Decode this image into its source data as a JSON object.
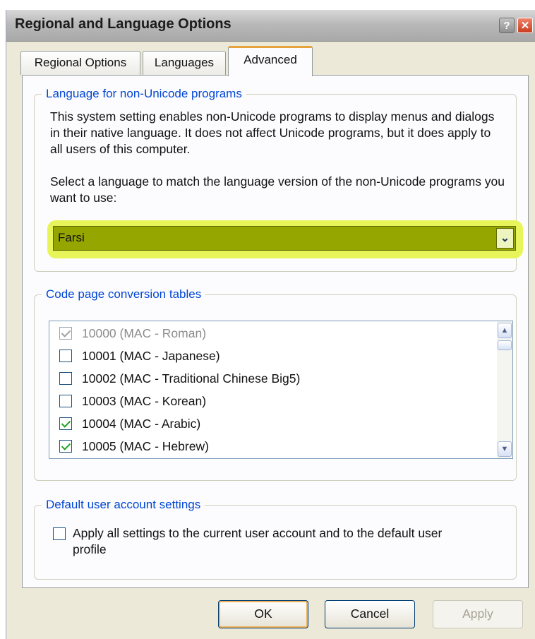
{
  "window": {
    "title": "Regional and Language Options",
    "help_label": "?",
    "close_label": "✕"
  },
  "tabs": [
    {
      "label": "Regional Options"
    },
    {
      "label": "Languages"
    },
    {
      "label": "Advanced"
    }
  ],
  "nonunicode": {
    "legend": "Language for non-Unicode programs",
    "description": "This system setting enables non-Unicode programs to display menus and dialogs in their native language. It does not affect Unicode programs, but it does apply to all users of this computer.",
    "select_prompt": "Select a language to match the language version of the non-Unicode programs you want to use:",
    "selected_language": "Farsi",
    "dropdown_icon": "chevron-down-icon"
  },
  "codepages": {
    "legend": "Code page conversion tables",
    "items": [
      {
        "label": "10000 (MAC - Roman)",
        "checked": true,
        "disabled": true
      },
      {
        "label": "10001 (MAC - Japanese)",
        "checked": false,
        "disabled": false
      },
      {
        "label": "10002 (MAC - Traditional Chinese Big5)",
        "checked": false,
        "disabled": false
      },
      {
        "label": "10003 (MAC - Korean)",
        "checked": false,
        "disabled": false
      },
      {
        "label": "10004 (MAC - Arabic)",
        "checked": true,
        "disabled": false
      },
      {
        "label": "10005 (MAC - Hebrew)",
        "checked": true,
        "disabled": false
      }
    ]
  },
  "defaults": {
    "legend": "Default user account settings",
    "apply_all_label": "Apply all settings to the current user account and to the default user profile",
    "apply_all_checked": false
  },
  "buttons": {
    "ok": "OK",
    "cancel": "Cancel",
    "apply": "Apply"
  },
  "colors": {
    "highlight": "#e8f55a",
    "legend_blue": "#0046d5",
    "default_button_ring": "#f0b15a"
  }
}
